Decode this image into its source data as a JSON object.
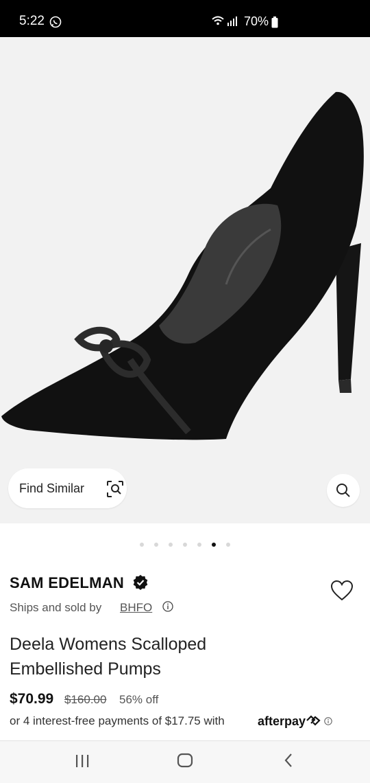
{
  "status_bar": {
    "time": "5:22",
    "battery": "70%",
    "icons": [
      "whatsapp-icon",
      "wifi-icon",
      "signal-icon",
      "battery-icon"
    ]
  },
  "product_image": {
    "find_similar_label": "Find Similar",
    "carousel_total": 7,
    "carousel_active": 6
  },
  "product": {
    "brand": "SAM EDELMAN",
    "ships_prefix": "Ships and sold by",
    "seller": "BHFO",
    "title": "Deela Womens Scalloped Embellished Pumps",
    "price": "$70.99",
    "original_price": "$160.00",
    "discount": "56% off",
    "installments_text": "or 4 interest-free payments of $17.75 with",
    "afterpay_brand": "afterpay"
  },
  "colors": {
    "status_bar": "#000000",
    "image_bg": "#f2f2f2",
    "active_dot": "#111111"
  }
}
